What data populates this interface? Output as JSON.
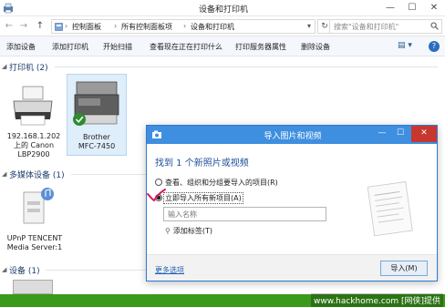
{
  "window": {
    "title": "设备和打印机",
    "controls": [
      "—",
      "☐",
      "✕"
    ]
  },
  "address": {
    "nav": [
      "←",
      "→",
      "↑"
    ],
    "crumbs": [
      "控制面板",
      "所有控制面板项",
      "设备和打印机"
    ],
    "search_placeholder": "搜索\"设备和打印机\""
  },
  "toolbar": {
    "items": [
      "添加设备",
      "添加打印机",
      "开始扫描",
      "查看现在正在打印什么",
      "打印服务器属性",
      "删除设备"
    ],
    "view_label": "▤ ▾",
    "help_label": "?"
  },
  "groups": {
    "printers": {
      "title": "打印机 (2)"
    },
    "media": {
      "title": "多媒体设备 (1)"
    },
    "devices": {
      "title": "设备 (1)"
    }
  },
  "devices": {
    "canon": {
      "line1": "192.168.1.202",
      "line2": "上的 Canon",
      "line3": "LBP2900"
    },
    "brother": {
      "line1": "Brother",
      "line2": "MFC-7450"
    },
    "upnp": {
      "line1": "UPnP TENCENT",
      "line2": "Media Server:1"
    }
  },
  "dialog": {
    "title": "导入图片和视频",
    "heading": "找到 1 个新照片或视频",
    "option_review": "查看、组织和分组要导入的项目(R)",
    "option_import_all": "立即导入所有新项目(A)",
    "name_placeholder": "输入名称",
    "add_tags": "添加标签(T)",
    "more_options": "更多选项",
    "import_button": "导入(M)"
  },
  "watermark": "www.hackhome.com [网侠]提供",
  "colors": {
    "accent": "#3f8fe0",
    "close": "#c7372f",
    "link": "#1a5fb4",
    "strip": "#3a9a1a"
  }
}
